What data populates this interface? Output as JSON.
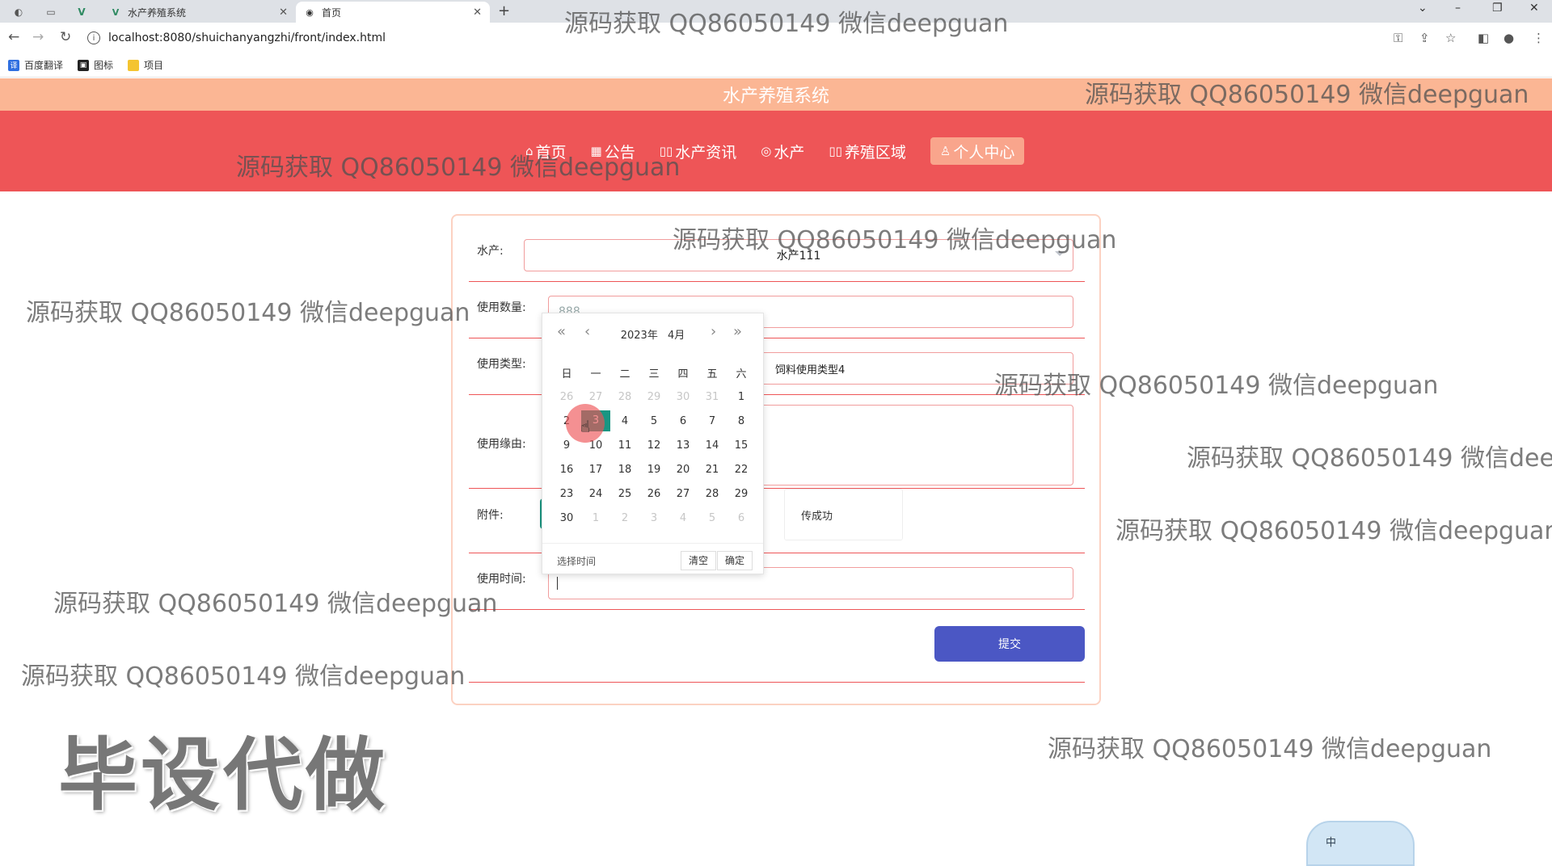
{
  "browser": {
    "tabs": [
      {
        "title": "水产养殖系统",
        "icon": "vue-logo-icon"
      },
      {
        "title": "首页",
        "icon": "globe-icon"
      }
    ],
    "url": "localhost:8080/shuichanyangzhi/front/index.html",
    "bookmarks": [
      {
        "label": "百度翻译",
        "color": "#2f6fe0"
      },
      {
        "label": "图标",
        "color": "#222222"
      },
      {
        "label": "项目",
        "color": "#f4c430"
      }
    ]
  },
  "header": {
    "title": "水产养殖系统",
    "menu": [
      {
        "icon": "⌂",
        "label": "首页"
      },
      {
        "icon": "▦",
        "label": "公告"
      },
      {
        "icon": "▯▯",
        "label": "水产资讯"
      },
      {
        "icon": "◎",
        "label": "水产"
      },
      {
        "icon": "▯▯",
        "label": "养殖区域"
      },
      {
        "icon": "♙",
        "label": "个人中心"
      }
    ]
  },
  "form": {
    "fields": {
      "aquatic": {
        "label": "水产:",
        "value": "水产111"
      },
      "quantity": {
        "label": "使用数量:",
        "value": "888"
      },
      "use_type": {
        "label": "使用类型:",
        "value": "饲料使用类型4"
      },
      "reason": {
        "label": "使用缘由:",
        "value": ""
      },
      "attachment": {
        "label": "附件:",
        "tip": "传成功"
      },
      "use_time": {
        "label": "使用时间:",
        "value": ""
      }
    },
    "submit_label": "提交"
  },
  "datepicker": {
    "year": "2023年",
    "month": "4月",
    "weekdays": [
      "日",
      "一",
      "二",
      "三",
      "四",
      "五",
      "六"
    ],
    "weeks": [
      [
        "26",
        "27",
        "28",
        "29",
        "30",
        "31",
        "1"
      ],
      [
        "2",
        "3",
        "4",
        "5",
        "6",
        "7",
        "8"
      ],
      [
        "9",
        "10",
        "11",
        "12",
        "13",
        "14",
        "15"
      ],
      [
        "16",
        "17",
        "18",
        "19",
        "20",
        "21",
        "22"
      ],
      [
        "23",
        "24",
        "25",
        "26",
        "27",
        "28",
        "29"
      ],
      [
        "30",
        "1",
        "2",
        "3",
        "4",
        "5",
        "6"
      ]
    ],
    "selected": "3",
    "footer": {
      "pick_time": "选择时间",
      "clear": "清空",
      "confirm": "确定"
    }
  },
  "watermark": {
    "text": "源码获取 QQ86050149 微信deepguan",
    "big_text": "毕设代做"
  },
  "ime": {
    "label": "中"
  }
}
